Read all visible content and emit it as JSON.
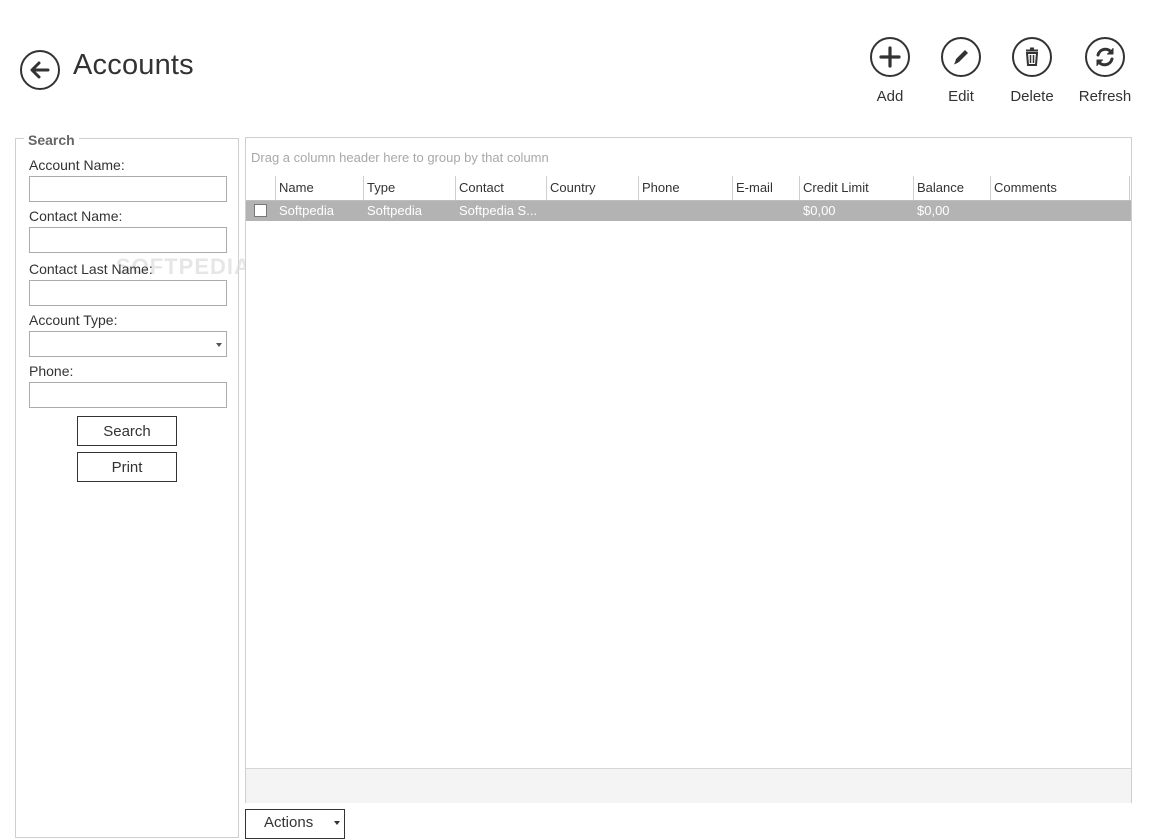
{
  "header": {
    "title": "Accounts",
    "back_icon": "back-arrow-icon"
  },
  "toolbar": {
    "buttons": [
      {
        "label": "Add",
        "icon": "plus-icon"
      },
      {
        "label": "Edit",
        "icon": "pencil-icon"
      },
      {
        "label": "Delete",
        "icon": "trash-icon"
      },
      {
        "label": "Refresh",
        "icon": "refresh-icon"
      }
    ]
  },
  "search": {
    "title": "Search",
    "fields": [
      {
        "label": "Account Name:",
        "value": ""
      },
      {
        "label": "Contact Name:",
        "value": ""
      },
      {
        "label": "Contact Last Name:",
        "value": ""
      },
      {
        "label": "Account Type:",
        "value": ""
      },
      {
        "label": "Phone:",
        "value": ""
      }
    ],
    "search_button": "Search",
    "print_button": "Print"
  },
  "watermark": "SOFTPEDIA",
  "grid": {
    "group_hint": "Drag a column header here to group by that column",
    "columns": [
      "Name",
      "Type",
      "Contact",
      "Country",
      "Phone",
      "E-mail",
      "Credit Limit",
      "Balance",
      "Comments"
    ],
    "rows": [
      {
        "checked": false,
        "cells": [
          "Softpedia",
          "Softpedia",
          "Softpedia S...",
          "",
          "",
          "",
          "$0,00",
          "$0,00",
          ""
        ]
      }
    ]
  },
  "actions": {
    "label": "Actions"
  },
  "colors": {
    "selected_row": "#b3b3b3",
    "text": "#333333",
    "border": "#cfcfcf"
  }
}
